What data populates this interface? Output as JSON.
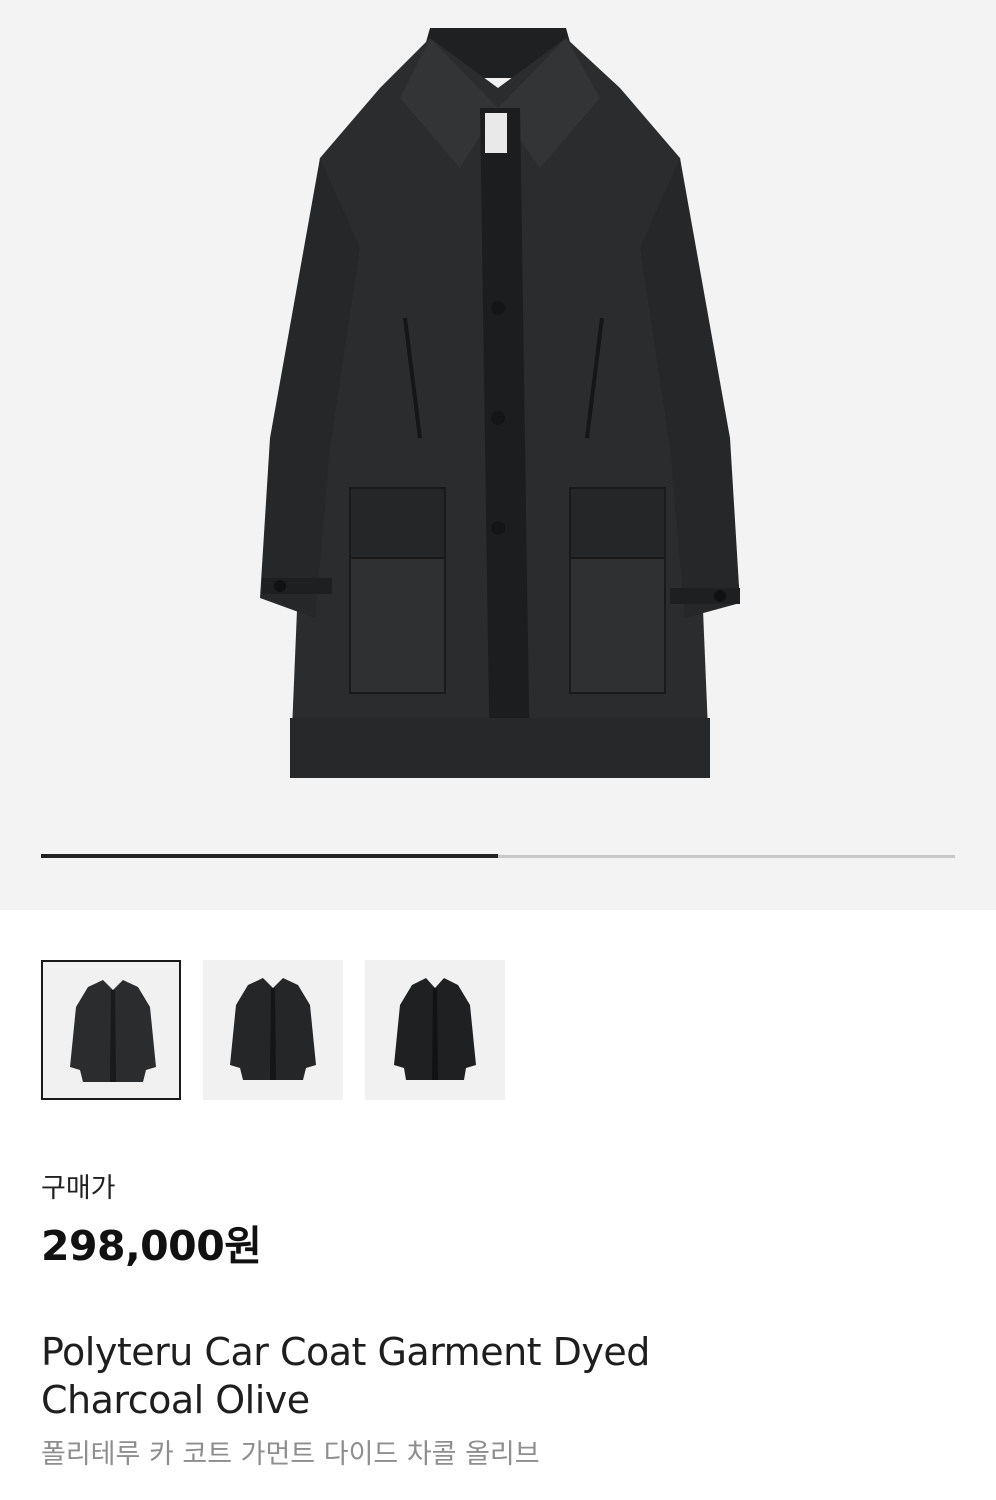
{
  "product": {
    "image_icon": "charcoal-car-coat-image",
    "gallery_position": 0.5,
    "thumbnails": [
      {
        "icon": "coat-front-thumbnail",
        "active": true
      },
      {
        "icon": "coat-front-thumbnail",
        "active": false
      },
      {
        "icon": "coat-front-thumbnail",
        "active": false
      }
    ],
    "price_label": "구매가",
    "price": "298,000원",
    "name_en": "Polyteru Car Coat Garment Dyed Charcoal Olive",
    "name_ko": "폴리테루 카 코트 가먼트 다이드 차콜 올리브"
  },
  "colors": {
    "hero_bg": "#f3f3f3",
    "coat": "#2b2c2d",
    "progress_fill": "#222222",
    "progress_track": "#c8c8c8",
    "subtext": "#8e8e8e"
  }
}
